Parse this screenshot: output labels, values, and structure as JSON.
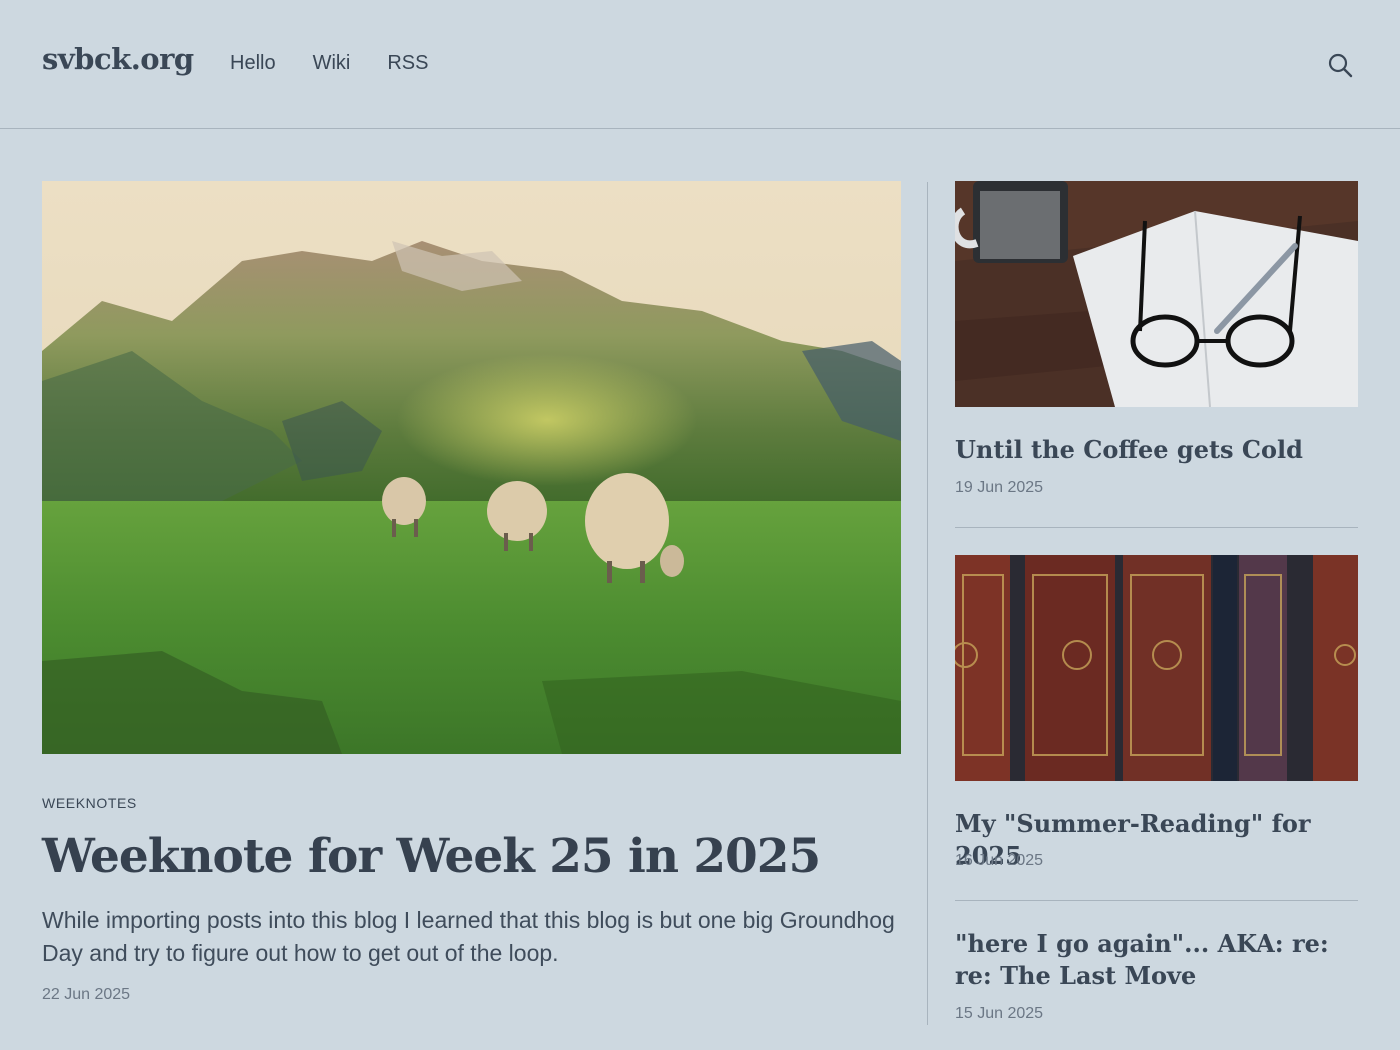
{
  "header": {
    "logo": "svbck.org",
    "nav": [
      "Hello",
      "Wiki",
      "RSS"
    ],
    "search_icon": "search-icon"
  },
  "featured": {
    "category": "WEEKNOTES",
    "title": "Weeknote for Week 25 in 2025",
    "excerpt": "While importing posts into this blog I learned that this blog is but one big Groundhog Day and try to figure out how to get out of the loop.",
    "date": "22 Jun 2025"
  },
  "sidebar": [
    {
      "title": "Until the Coffee gets Cold",
      "date": "19 Jun 2025"
    },
    {
      "title": "My \"Summer-Reading\" for 2025",
      "date": "16 Jun 2025"
    },
    {
      "title": "\"here I go again\"... AKA: re: re: The Last Move",
      "date": "15 Jun 2025"
    }
  ]
}
